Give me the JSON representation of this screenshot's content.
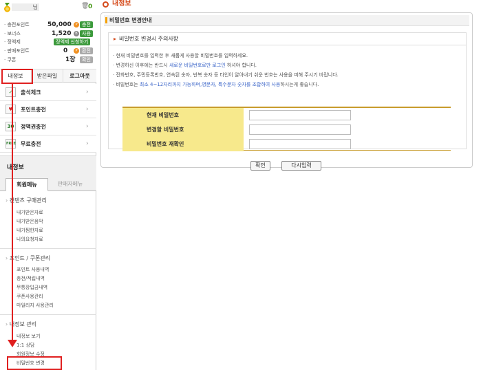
{
  "user": {
    "name": "님",
    "trash_count": "0",
    "rows": [
      {
        "label": "충전포인트",
        "value": "50,000",
        "action": "충전"
      },
      {
        "label": "보너스",
        "value": "1,520",
        "action": "사용"
      },
      {
        "label": "정액제",
        "value": "",
        "action": "정액제 신청하기"
      },
      {
        "label": "판매포인트",
        "value": "0",
        "action": "환전"
      },
      {
        "label": "쿠폰",
        "value": "1장",
        "action": "확인"
      }
    ]
  },
  "top_tabs": [
    "내정보",
    "받은파일",
    "로그아웃"
  ],
  "menu": [
    {
      "label": "출석체크",
      "icon": "check-icon"
    },
    {
      "label": "포인트충전",
      "icon": "point-charge-icon"
    },
    {
      "label": "정액권충전",
      "icon": "ticket-30-icon"
    },
    {
      "label": "무료충전",
      "icon": "free-charge-icon"
    }
  ],
  "side_heading": "내정보",
  "sub_tabs": [
    "회원메뉴",
    "판매자메뉴"
  ],
  "sections": [
    {
      "title": "컨텐츠 구매관리",
      "links": [
        "내가받은자료",
        "내가받은음악",
        "내가찜한자료",
        "나의요청자료"
      ]
    },
    {
      "title": "포인트 / 쿠폰관리",
      "links": [
        "포인트 사용내역",
        "충전/적립내역",
        "무통장입금내역",
        "쿠폰사용관리",
        "마일리지 사용관리"
      ]
    },
    {
      "title": "내정보 관리",
      "links": [
        "내정보 보기",
        "1:1 상담",
        "회원정보 수정",
        "비밀번호 변경"
      ]
    }
  ],
  "page": {
    "title": "내정보",
    "panel_title": "비밀번호 변경안내",
    "notice_title": "비밀번호 변경시 주의사항",
    "notice_lines": [
      {
        "a": "현재 비밀번호를 입력한 후 새롭게 사용할 비밀번호를 입력하세요.",
        "b": "",
        "c": ""
      },
      {
        "a": "변경하신 이후에는 반드시 ",
        "b": "새로운 비밀번호로만 로그인",
        "c": " 하셔야 합니다."
      },
      {
        "a": "전화번호, 주민등록번호, 연속된 숫자, 반복 숫자 등 타인이 알아내기 쉬운 번호는 사용을 피해 주시기 바랍니다.",
        "b": "",
        "c": ""
      },
      {
        "a": "비밀번호는 ",
        "b": "최소 4~12자리까지 가능하며,영문자, 특수문자 숫자를 조합하여 사용",
        "c": "하시는게 좋습니다."
      }
    ],
    "form": [
      {
        "label": "현재 비밀번호",
        "value": ""
      },
      {
        "label": "변경할 비밀번호",
        "value": ""
      },
      {
        "label": "비밀번호 재확인",
        "value": ""
      }
    ],
    "confirm_label": "확인",
    "reset_label": "다시입력"
  },
  "colors": {
    "accent": "#d54a1a",
    "green": "#3c9a3c",
    "highlight": "#e02020",
    "form_label_bg": "#f7e98c"
  }
}
